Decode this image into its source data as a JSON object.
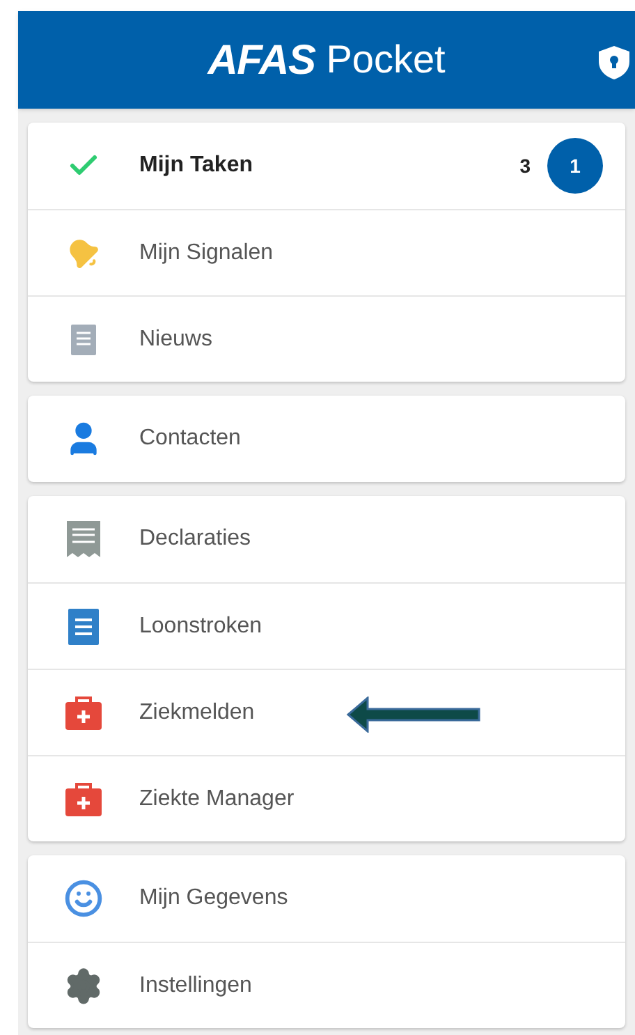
{
  "header": {
    "brand": "AFAS",
    "product": "Pocket"
  },
  "groups": [
    {
      "items": [
        {
          "kind": "check",
          "label": "Mijn Taken",
          "bold": true,
          "count": "3",
          "badge": "1",
          "arrow": false
        },
        {
          "kind": "bell",
          "label": "Mijn Signalen",
          "bold": false,
          "arrow": false
        },
        {
          "kind": "news",
          "label": "Nieuws",
          "bold": false,
          "arrow": false
        }
      ]
    },
    {
      "items": [
        {
          "kind": "person",
          "label": "Contacten",
          "bold": false,
          "arrow": false
        }
      ]
    },
    {
      "items": [
        {
          "kind": "receipt",
          "label": "Declaraties",
          "bold": false,
          "arrow": false
        },
        {
          "kind": "payslip",
          "label": "Loonstroken",
          "bold": false,
          "arrow": false
        },
        {
          "kind": "medkit",
          "label": "Ziekmelden",
          "bold": false,
          "arrow": true
        },
        {
          "kind": "medkit",
          "label": "Ziekte Manager",
          "bold": false,
          "arrow": false
        }
      ]
    },
    {
      "items": [
        {
          "kind": "smiley",
          "label": "Mijn Gegevens",
          "bold": false,
          "arrow": false
        },
        {
          "kind": "gear",
          "label": "Instellingen",
          "bold": false,
          "arrow": false
        }
      ]
    }
  ]
}
